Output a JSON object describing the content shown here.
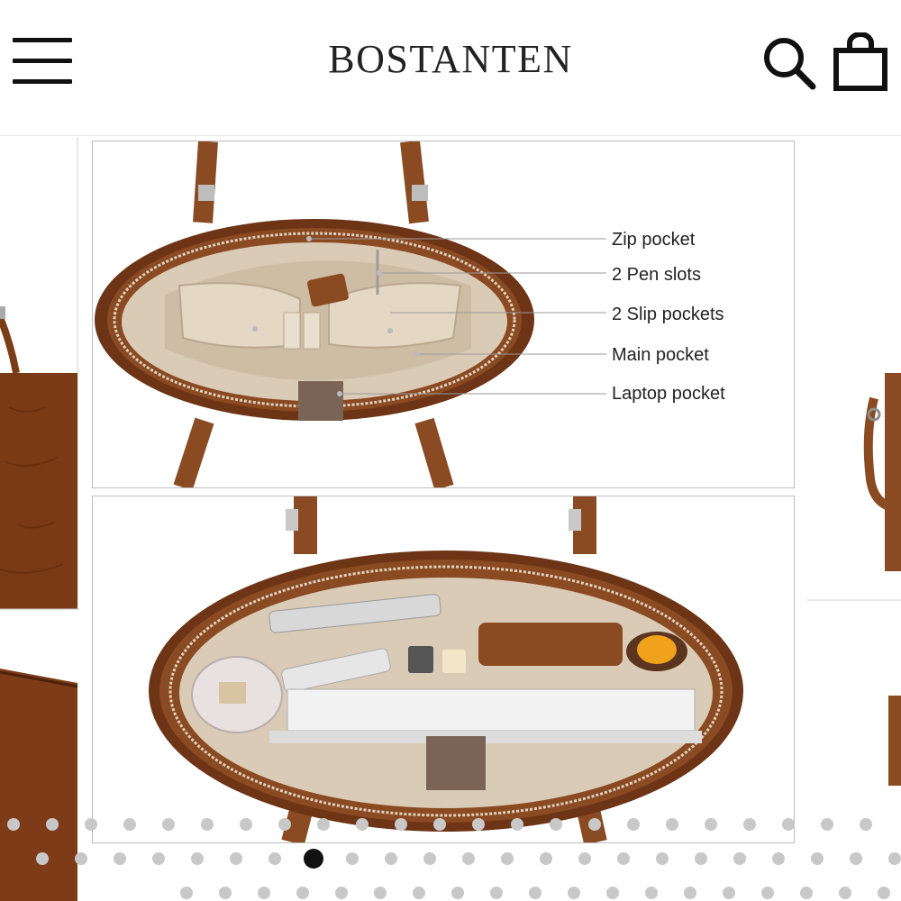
{
  "header": {
    "brand": "BOSTANTEN",
    "menu_icon": "hamburger-menu-icon",
    "search_icon": "search-icon",
    "cart_icon": "shopping-bag-icon"
  },
  "gallery": {
    "main_image": {
      "labels": [
        "Zip pocket",
        "2 Pen slots",
        "2 Slip pockets",
        "Main pocket",
        "Laptop pocket"
      ]
    },
    "page_indicator": {
      "active_index": 1,
      "row_count": 3
    }
  },
  "colors": {
    "leather": "#8a4a22",
    "lining": "#d9cbb5",
    "active_dot": "#111111",
    "inactive_dot": "#c8c8c8"
  }
}
